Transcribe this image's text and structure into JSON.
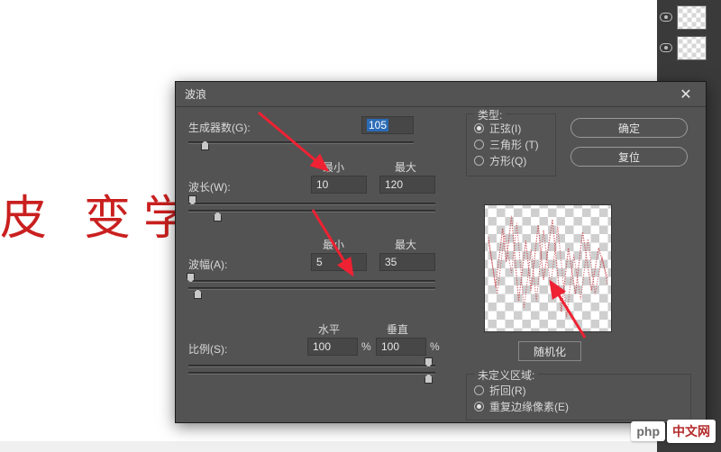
{
  "bg_text": "皮  变学",
  "dialog": {
    "title": "波浪",
    "close_glyph": "✕",
    "generators": {
      "label": "生成器数(G):",
      "value": "105"
    },
    "wavelength": {
      "label": "波长(W):",
      "min_label": "最小",
      "max_label": "最大",
      "min": "10",
      "max": "120"
    },
    "amplitude": {
      "label": "波幅(A):",
      "min_label": "最小",
      "max_label": "最大",
      "min": "5",
      "max": "35"
    },
    "scale": {
      "label": "比例(S):",
      "horiz_label": "水平",
      "vert_label": "垂直",
      "horiz": "100",
      "vert": "100",
      "pct": "%"
    },
    "type": {
      "legend": "类型:",
      "options": [
        {
          "label": "正弦(I)",
          "checked": true
        },
        {
          "label": "三角形 (T)",
          "checked": false
        },
        {
          "label": "方形(Q)",
          "checked": false
        }
      ]
    },
    "ok": "确定",
    "reset": "复位",
    "randomize": "随机化",
    "undefined_area": {
      "legend": "未定义区域:",
      "options": [
        {
          "label": "折回(R)",
          "checked": false
        },
        {
          "label": "重复边缘像素(E)",
          "checked": true
        }
      ]
    }
  },
  "watermark": {
    "left": "php",
    "right": "中文网"
  }
}
